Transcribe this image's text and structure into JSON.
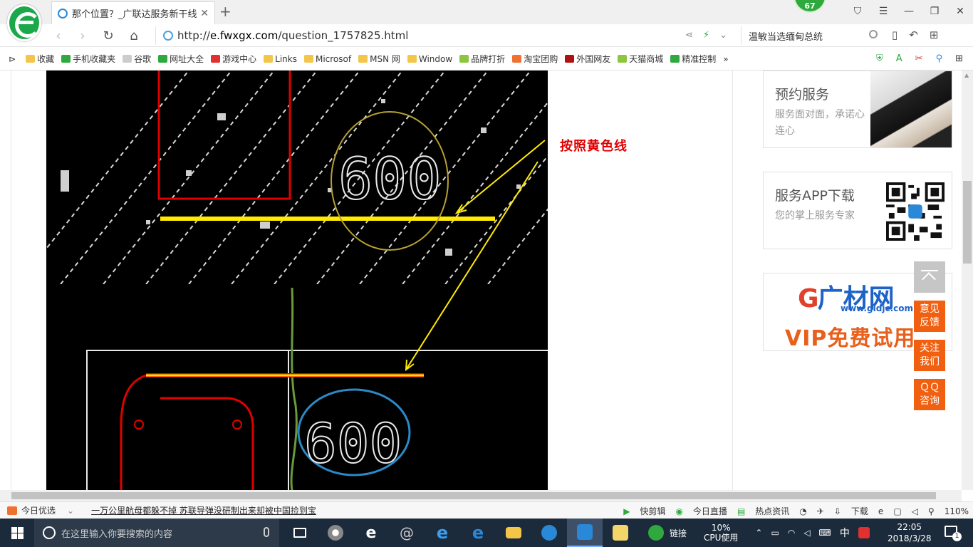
{
  "browser": {
    "tab_title": "那个位置？_广联达服务新干线",
    "badge": "67",
    "url_host": "e.fwxgx.com",
    "url_prefix": "http://",
    "url_path": "/question_1757825.html",
    "search_text": "温敏当选缅甸总统"
  },
  "bookmarks": [
    {
      "label": "收藏",
      "icon": "star-icon",
      "color": "#f3c64a"
    },
    {
      "label": "手机收藏夹",
      "icon": "phone-icon",
      "color": "#2fa93e"
    },
    {
      "label": "谷歌",
      "icon": "page-icon",
      "color": "#cccccc"
    },
    {
      "label": "网址大全",
      "icon": "site-icon",
      "color": "#2fa93e"
    },
    {
      "label": "游戏中心",
      "icon": "game-icon",
      "color": "#e03030"
    },
    {
      "label": "Links",
      "icon": "folder-icon",
      "color": "#f3c64a"
    },
    {
      "label": "Microsof",
      "icon": "folder-icon",
      "color": "#f3c64a"
    },
    {
      "label": "MSN 网",
      "icon": "folder-icon",
      "color": "#f3c64a"
    },
    {
      "label": "Window",
      "icon": "folder-icon",
      "color": "#f3c64a"
    },
    {
      "label": "品牌打折",
      "icon": "leaf-icon",
      "color": "#8cc63f"
    },
    {
      "label": "淘宝团购",
      "icon": "taobao-icon",
      "color": "#f07030"
    },
    {
      "label": "外国网友",
      "icon": "flag-icon",
      "color": "#b01010"
    },
    {
      "label": "天猫商城",
      "icon": "leaf-icon",
      "color": "#8cc63f"
    },
    {
      "label": "精准控制",
      "icon": "chat-icon",
      "color": "#2fa93e"
    }
  ],
  "content": {
    "annotation": "按照黄色线",
    "cad_label_top": "600",
    "cad_label_bottom": "600"
  },
  "sidebar": {
    "service_title": "预约服务",
    "service_sub": "服务面对面，承诺心连心",
    "app_title": "服务APP下载",
    "app_sub": "您的掌上服务专家",
    "ad_logo_main": "G",
    "ad_logo_text": "广材网",
    "ad_url": "www.gldjc.com",
    "ad_vip": "VIP免费试用"
  },
  "float_buttons": {
    "feedback": "意见反馈",
    "follow": "关注我们",
    "qq": "ＱＱ咨询"
  },
  "statusbar": {
    "left_label": "今日优选",
    "news": "一万公里航母都躲不掉 苏联导弹没研制出来却被中国捡到宝",
    "kuaijianji": "快剪辑",
    "live": "今日直播",
    "hot": "热点资讯",
    "download": "下载",
    "zoom": "110%"
  },
  "taskbar": {
    "search_placeholder": "在这里输入你要搜索的内容",
    "link_label": "链接",
    "cpu_value": "10%",
    "cpu_label": "CPU使用",
    "ime": "中",
    "time": "22:05",
    "date": "2018/3/28",
    "notifications": "1"
  }
}
